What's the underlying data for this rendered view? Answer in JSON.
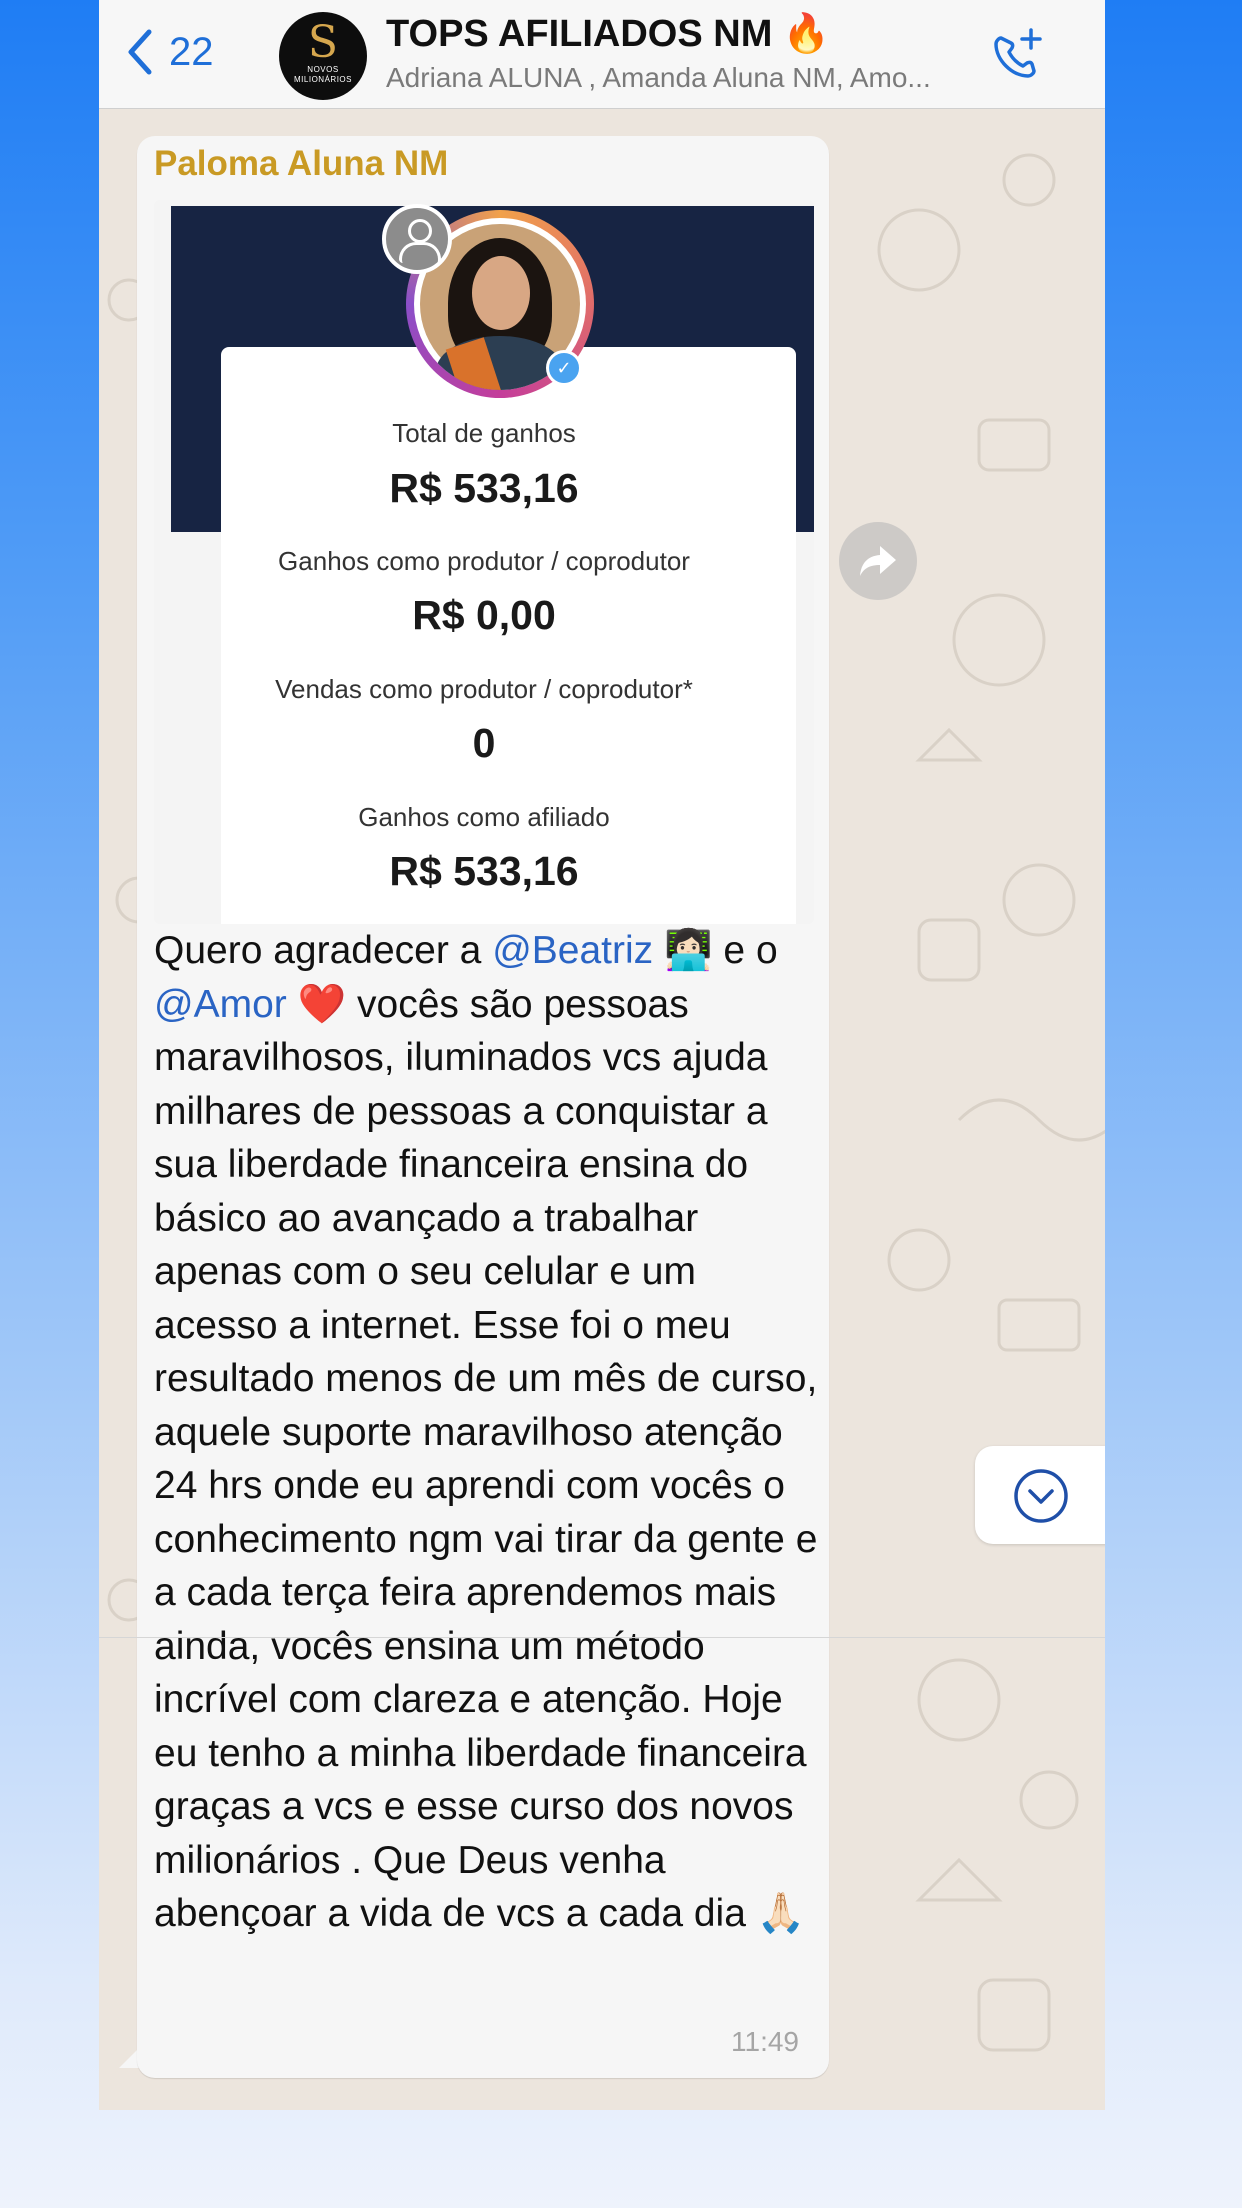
{
  "header": {
    "back_count": "22",
    "group_name": "TOPS AFILIADOS NM 🔥",
    "members": "Adriana ALUNA , Amanda Aluna NM, Amo...",
    "avatar_letter": "S",
    "avatar_text": "NOVOS MILIONÁRIOS"
  },
  "message": {
    "sender": "Paloma Aluna NM",
    "time": "11:49",
    "text_part1": "Quero agradecer a ",
    "mention1": "@Beatriz",
    "text_part2": " 👩🏻‍💻 e o ",
    "mention2": "@Amor",
    "text_part3": " ❤️ vocês são pessoas maravilhosos, iluminados vcs ajuda milhares de pessoas a conquistar a sua liberdade financeira ensina do básico ao avançado a trabalhar apenas com o seu celular e um acesso a internet. Esse foi o meu resultado menos de um mês de curso,  aquele suporte maravilhoso atenção 24 hrs onde eu aprendi com vocês o conhecimento ngm vai tirar da gente e a cada terça feira aprendemos mais ainda, vocês ensina um método incrível com clareza e atenção. Hoje eu tenho a minha liberdade financeira graças a vcs e esse curso dos novos milionários . Que Deus venha abençoar a vida de vcs a cada dia 🙏🏻"
  },
  "screenshot": {
    "total_label": "Total de ganhos",
    "total_value": "R$ 533,16",
    "producer_label": "Ganhos como produtor / coprodutor",
    "producer_value": "R$ 0,00",
    "sales_label": "Vendas como produtor / coprodutor*",
    "sales_value": "0",
    "affiliate_label": "Ganhos como afiliado",
    "affiliate_value": "R$ 533,16"
  },
  "icons": {
    "back": "chevron-left-icon",
    "call_add": "phone-plus-icon",
    "forward": "forward-icon",
    "scroll_down": "chevron-down-circle-icon"
  },
  "colors": {
    "accent": "#1f6fd8",
    "sender": "#c99a24",
    "mention": "#2a64c4",
    "bubble": "#f6f6f6",
    "chat_bg": "#ece5dd"
  }
}
